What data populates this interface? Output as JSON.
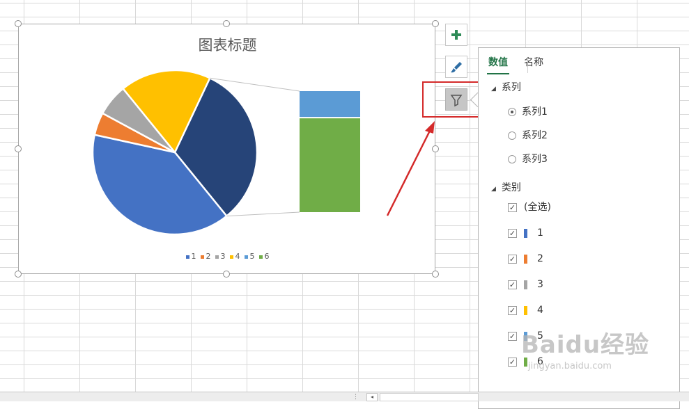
{
  "chart": {
    "title": "图表标题"
  },
  "chart_data": {
    "type": "pie",
    "variant": "pie-of-pie (bar of pie)",
    "title": "图表标题",
    "categories": [
      "1",
      "2",
      "3",
      "4",
      "5",
      "6"
    ],
    "values": [
      44,
      5,
      7,
      20,
      8,
      28
    ],
    "secondary_bar_items": [
      "5",
      "6"
    ],
    "colors": [
      "#4472c4",
      "#ed7d31",
      "#a5a5a5",
      "#ffc000",
      "#5b9bd5",
      "#70ad47"
    ],
    "pie_order_note": "6 appears in the primary pie as the dark-blue 'other' slice",
    "other_color": "#264478",
    "legend_position": "bottom"
  },
  "side_buttons": {
    "add": "plus-icon",
    "style": "brush-icon",
    "filter": "filter-icon"
  },
  "filter_pane": {
    "tabs": [
      {
        "label": "数值",
        "active": true
      },
      {
        "label": "名称",
        "active": false
      }
    ],
    "series_heading": "系列",
    "series": [
      {
        "label": "系列1",
        "selected": true
      },
      {
        "label": "系列2",
        "selected": false
      },
      {
        "label": "系列3",
        "selected": false
      }
    ],
    "category_heading": "类别",
    "categories": [
      {
        "label": "(全选)",
        "checked": true
      },
      {
        "label": "1",
        "checked": true,
        "color": "#4472c4"
      },
      {
        "label": "2",
        "checked": true,
        "color": "#ed7d31"
      },
      {
        "label": "3",
        "checked": true,
        "color": "#a5a5a5"
      },
      {
        "label": "4",
        "checked": true,
        "color": "#ffc000"
      },
      {
        "label": "5",
        "checked": true,
        "color": "#5b9bd5"
      },
      {
        "label": "6",
        "checked": true,
        "color": "#70ad47"
      }
    ]
  },
  "watermark": {
    "main": "Baidu经验",
    "sub": "jingyan.baidu.com"
  },
  "accent_color": "#217346",
  "highlight_color": "#d42a2a"
}
